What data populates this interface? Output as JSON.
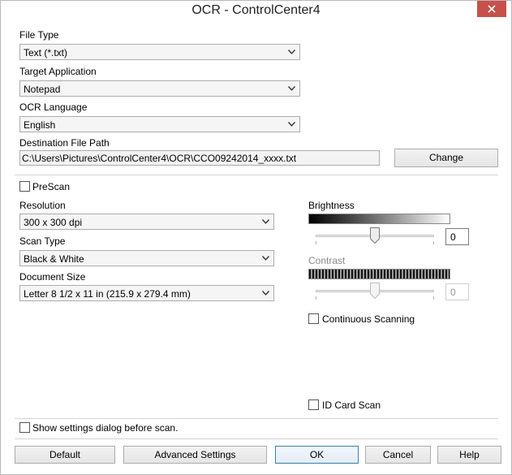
{
  "window": {
    "title": "OCR - ControlCenter4"
  },
  "file_type": {
    "label": "File Type",
    "value": "Text (*.txt)"
  },
  "target_application": {
    "label": "Target Application",
    "value": "Notepad"
  },
  "ocr_language": {
    "label": "OCR Language",
    "value": "English"
  },
  "destination": {
    "label": "Destination File Path",
    "value": "C:\\Users\\Pictures\\ControlCenter4\\OCR\\CCO09242014_xxxx.txt",
    "change_label": "Change"
  },
  "prescan": {
    "label": "PreScan",
    "checked": false
  },
  "resolution": {
    "label": "Resolution",
    "value": "300 x 300 dpi"
  },
  "scan_type": {
    "label": "Scan Type",
    "value": "Black & White"
  },
  "document_size": {
    "label": "Document Size",
    "value": "Letter 8 1/2 x 11 in (215.9 x 279.4 mm)"
  },
  "brightness": {
    "label": "Brightness",
    "value": "0",
    "slider_fraction": 0.5
  },
  "contrast": {
    "label": "Contrast",
    "value": "0",
    "enabled": false,
    "slider_fraction": 0.5
  },
  "continuous_scanning": {
    "label": "Continuous Scanning",
    "checked": false
  },
  "id_card_scan": {
    "label": "ID Card Scan",
    "checked": false
  },
  "show_settings": {
    "label": "Show settings dialog before scan.",
    "checked": false
  },
  "buttons": {
    "default": "Default",
    "advanced": "Advanced Settings",
    "ok": "OK",
    "cancel": "Cancel",
    "help": "Help"
  },
  "colors": {
    "close_button": "#c7504b",
    "default_button_border": "#3c7fb1"
  }
}
